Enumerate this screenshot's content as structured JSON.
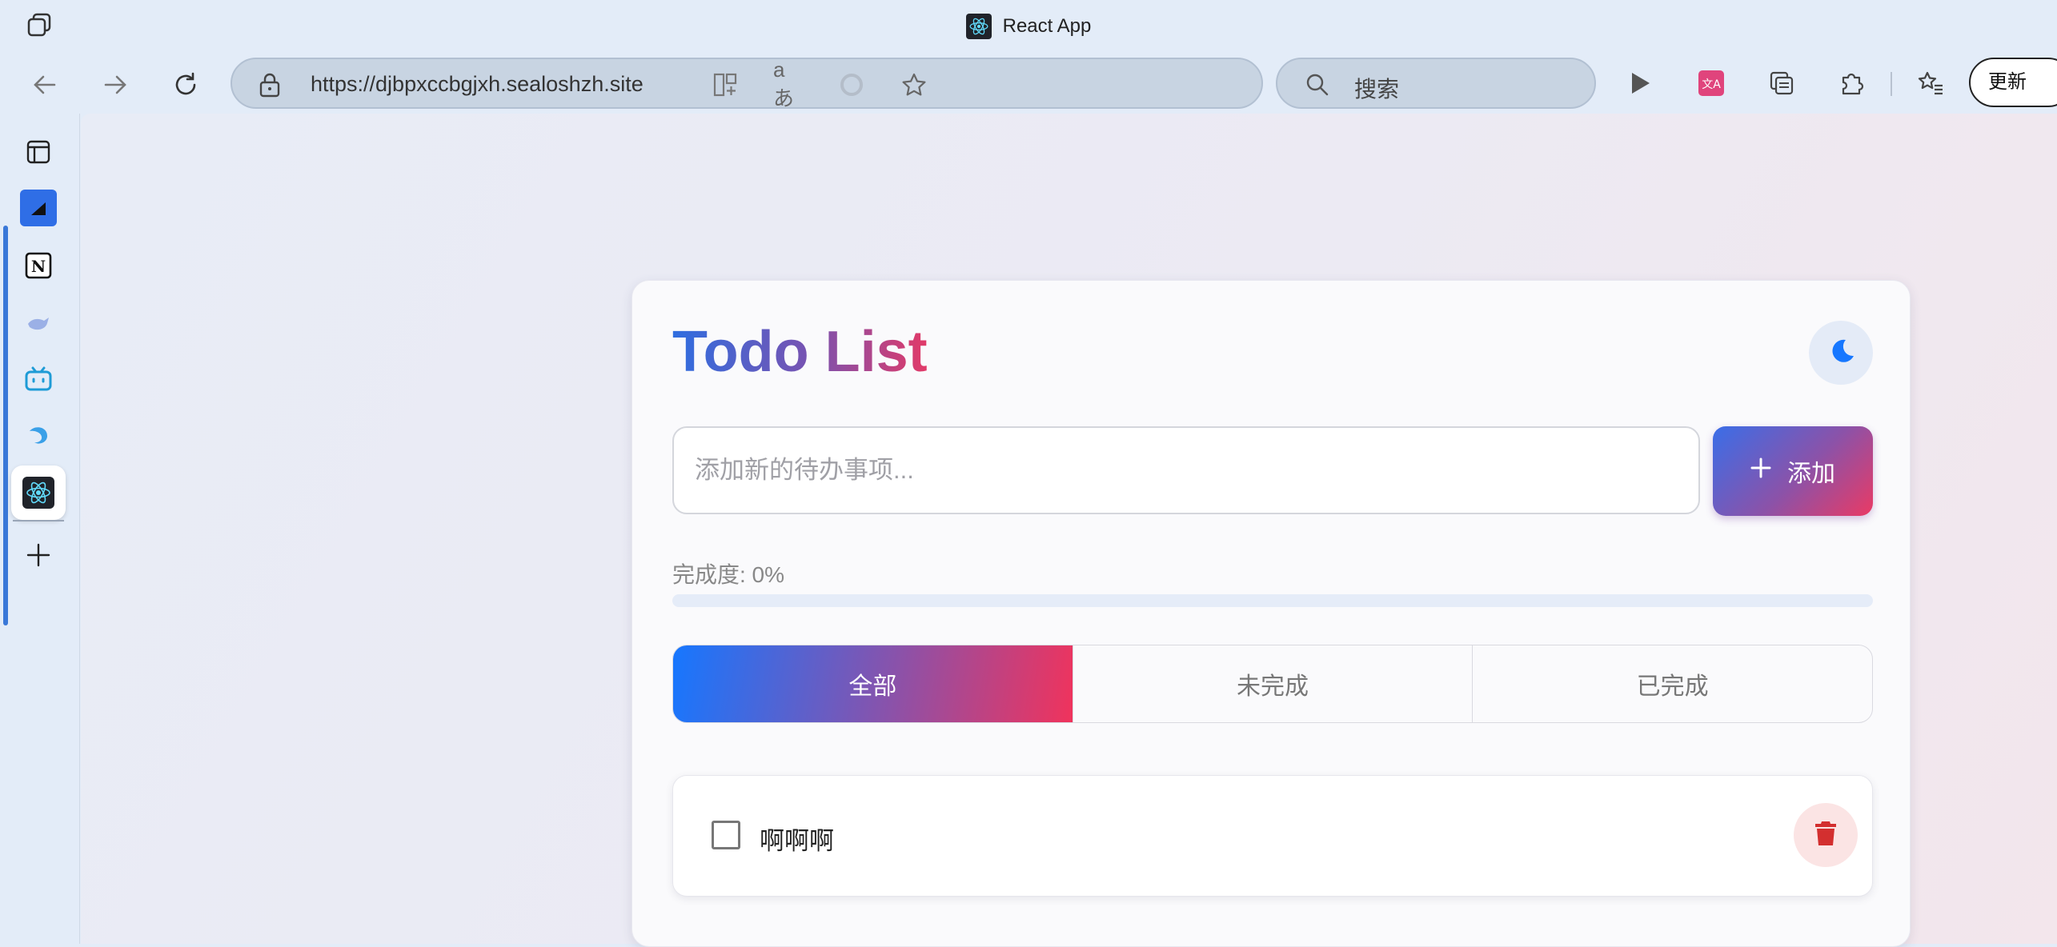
{
  "browser": {
    "tab_title": "React App",
    "url": "https://djbpxccbgjxh.sealoshzh.site",
    "search_placeholder": "搜索",
    "update_label": "更新"
  },
  "app": {
    "title_part1": "Todo",
    "title_part2": "List",
    "input_placeholder": "添加新的待办事项...",
    "add_label": "添加",
    "progress_label": "完成度: 0%",
    "progress_value": 0,
    "filters": [
      {
        "label": "全部",
        "active": true
      },
      {
        "label": "未完成",
        "active": false
      },
      {
        "label": "已完成",
        "active": false
      }
    ],
    "todos": [
      {
        "text": "啊啊啊",
        "completed": false
      }
    ]
  },
  "colors": {
    "accent_blue": "#1677ff",
    "accent_pink": "#f0335c",
    "delete_red": "#d32f2f"
  }
}
